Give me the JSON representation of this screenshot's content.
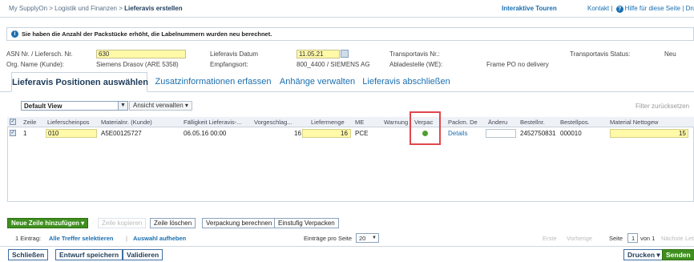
{
  "breadcrumb": {
    "part1": "My SupplyOn",
    "sep": " > ",
    "part2": "Logistik und Finanzen",
    "part3": "Lieferavis erstellen"
  },
  "toplinks": {
    "tours": "Interaktive Touren",
    "contact": "Kontakt |",
    "help": "Hilfe für diese Seite",
    "print": "| Drucke"
  },
  "info": {
    "text": "Sie haben die Anzahl der Packstücke erhöht, die Labelnummern wurden neu berechnet."
  },
  "header": {
    "asn_label": "ASN Nr. / Liefersch. Nr.",
    "asn_value": "630",
    "date_label": "Lieferavis Datum",
    "date_value": "11.05.21",
    "transport_label": "Transportavis Nr.:",
    "tstatus_label": "Transportavis Status:",
    "tstatus_value": "Neu",
    "org_label": "Org. Name (Kunde):",
    "org_value": "Siemens Drasov (ARE 5358)",
    "recv_label": "Empfangsort:",
    "recv_value": "800_4400 / SIEMENS AG",
    "unload_label": "Abladestelle (WE):",
    "unload_value": "Frame PO no delivery"
  },
  "tabs": [
    "Lieferavis Positionen auswählen",
    "Zusatzinformationen erfassen",
    "Anhänge verwalten",
    "Lieferavis abschließen"
  ],
  "toolbar": {
    "view": "Default View",
    "manage": "Ansicht verwalten",
    "filter_reset": "Filter zurücksetzen"
  },
  "grid": {
    "headers": [
      "Zeile",
      "Lieferscheinpos",
      "Materialnr. (Kunde)",
      "Fälligkeit Lieferavis-...",
      "Vorgeschlag...",
      "Liefermenge",
      "ME",
      "Warnung",
      "Verpac",
      "Packm. De",
      "Änderu",
      "Bestellnr.",
      "Bestellpos.",
      "Material Nettogew"
    ],
    "row": {
      "zeile": "1",
      "lspos": "010",
      "material": "A5E00125727",
      "due": "06.05.16 00:00",
      "proposed": "16",
      "qty": "16",
      "unit": "PCE",
      "details": "Details",
      "order": "2452750831",
      "orderpos": "000010",
      "weight": "15"
    }
  },
  "buttons": {
    "add": "Neue Zeile hinzufügen",
    "copy": "Zeile kopieren",
    "delete": "Zeile löschen",
    "calc": "Verpackung berechnen",
    "single": "Einstufig Verpacken"
  },
  "pager": {
    "count": "1 Eintrag:",
    "select_all": "Alle Treffer selektieren",
    "sep": "|",
    "deselect": "Auswahl aufheben",
    "per_page_label": "Einträge pro Seite",
    "per_page": "20",
    "first": "Erste",
    "prev": "Vorherige",
    "page_label": "Seite",
    "page": "1",
    "of": "von 1",
    "next": "Nächste",
    "last": "Letzte"
  },
  "footer": {
    "close": "Schließen",
    "draft": "Entwurf speichern",
    "validate": "Validieren",
    "print": "Drucken",
    "send": "Senden"
  },
  "colors": {
    "accent": "#1a6fb0",
    "green": "#3f8f1f",
    "highlight": "#e0474c",
    "yellow": "#fff9a8"
  }
}
